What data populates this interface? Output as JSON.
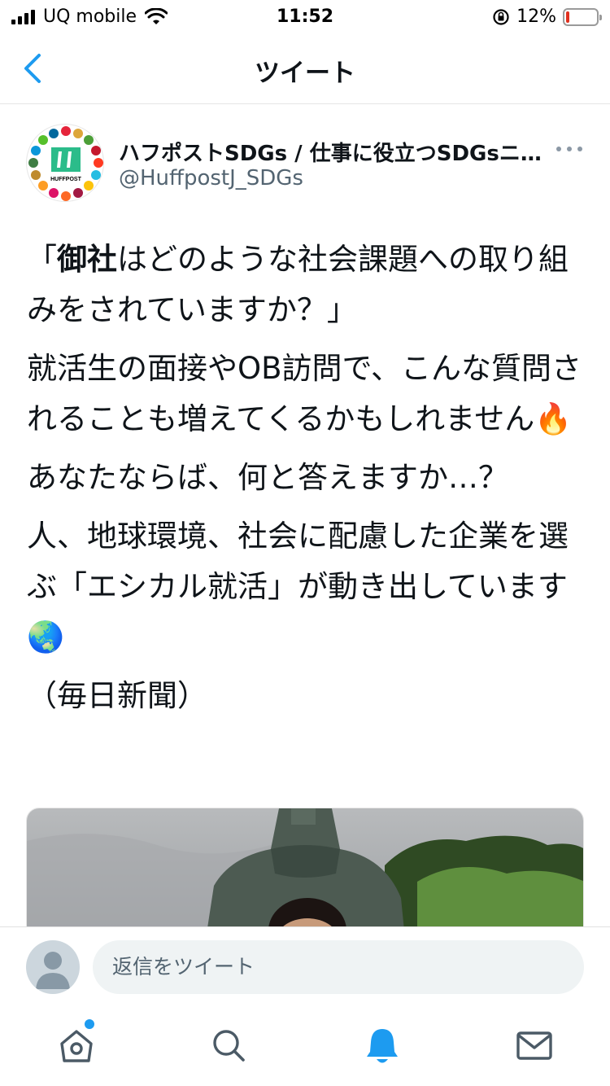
{
  "status_bar": {
    "carrier": "UQ mobile",
    "time": "11:52",
    "battery": "12%",
    "battery_level": 0.12
  },
  "nav": {
    "title": "ツイート"
  },
  "tweet": {
    "author_name": "ハフポストSDGs / 仕事に役立つSDGsニ…",
    "author_handle": "@HuffpostJ_SDGs",
    "avatar_text": "HUFFPOST",
    "quote_open": "「",
    "quote_bold": "御社",
    "quote_rest": "はどのような社会課題への取り組みをされていますか？」",
    "para2": "就活生の面接やOB訪問で、こんな質問されることも増えてくるかもしれません🔥",
    "para3": "あなたならば、何と答えますか…？",
    "para4": "人、地球環境、社会に配慮した企業を選ぶ「エシカル就活」が動き出しています🌏",
    "para5": "（毎日新聞）"
  },
  "reply": {
    "placeholder": "返信をツイート"
  },
  "tab_bar": {
    "items": [
      "home-icon",
      "search-icon",
      "bell-icon",
      "mail-icon"
    ],
    "active": "bell-icon",
    "accent": "#1d9bf0"
  }
}
